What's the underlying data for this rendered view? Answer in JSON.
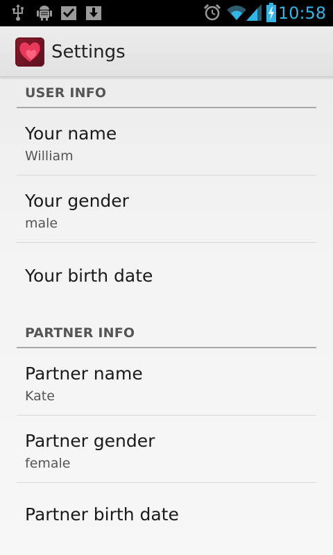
{
  "status_bar": {
    "time": "10:58",
    "icons": [
      "usb-icon",
      "android-debug-icon",
      "download-done-icon",
      "download-icon",
      "alarm-icon",
      "wifi-icon",
      "signal-icon",
      "battery-charging-icon"
    ],
    "accent": "#33b5e5"
  },
  "action_bar": {
    "title": "Settings",
    "app_icon": "heart-app-icon"
  },
  "sections": [
    {
      "header": "USER INFO",
      "items": [
        {
          "title": "Your name",
          "summary": "William"
        },
        {
          "title": "Your gender",
          "summary": "male"
        },
        {
          "title": "Your birth date",
          "summary": ""
        }
      ]
    },
    {
      "header": "PARTNER INFO",
      "items": [
        {
          "title": "Partner name",
          "summary": "Kate"
        },
        {
          "title": "Partner gender",
          "summary": "female"
        },
        {
          "title": "Partner birth date",
          "summary": ""
        }
      ]
    }
  ]
}
